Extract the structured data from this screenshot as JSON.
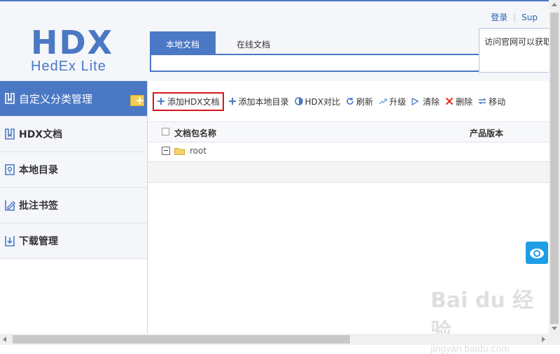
{
  "app": {
    "logo_main": "HDX",
    "logo_sub": "HedEx Lite"
  },
  "top_links": {
    "login": "登录",
    "support": "Sup"
  },
  "tabs": [
    {
      "label": "本地文档",
      "active": true
    },
    {
      "label": "在线文档",
      "active": false
    }
  ],
  "notice_text": "访问官网可以获取",
  "sidebar": {
    "items": [
      {
        "label": "自定义分类管理",
        "icon": "category-icon",
        "active": true
      },
      {
        "label": "HDX文档",
        "icon": "hdx-doc-icon",
        "active": false
      },
      {
        "label": "本地目录",
        "icon": "local-dir-icon",
        "active": false
      },
      {
        "label": "批注书签",
        "icon": "annotation-icon",
        "active": false
      },
      {
        "label": "下载管理",
        "icon": "download-icon",
        "active": false
      }
    ]
  },
  "toolbar": {
    "add_hdx": "添加HDX文档",
    "add_local_dir": "添加本地目录",
    "hdx_compare": "HDX对比",
    "refresh": "刷新",
    "upgrade": "升级",
    "clear": "清除",
    "delete": "删除",
    "move": "移动"
  },
  "grid": {
    "col_name": "文档包名称",
    "col_version": "产品版本",
    "rows": [
      {
        "name": "root"
      }
    ]
  },
  "watermark": {
    "big": "Bai du 经验",
    "small": "jingyan.baidu.com"
  },
  "colors": {
    "accent": "#4a78c4",
    "highlight_border": "#d9141b",
    "float_button": "#1d9ee6"
  }
}
